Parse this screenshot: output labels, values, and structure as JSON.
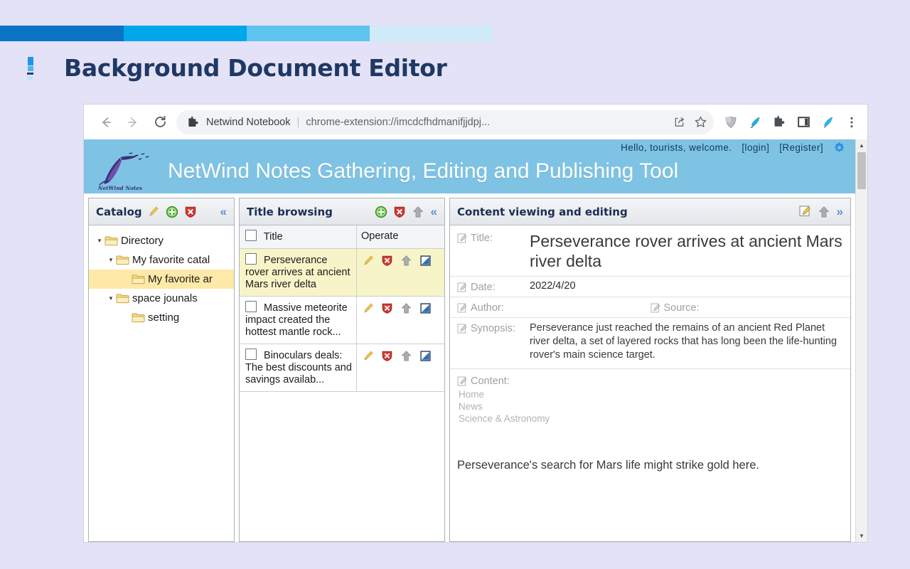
{
  "slide": {
    "title": "Background Document Editor",
    "accent_colors": [
      "#0a73c4",
      "#00a7eb",
      "#5cc4ee",
      "#cfeaf9"
    ],
    "background": "#e4e2f7"
  },
  "browser": {
    "back_icon": "back-arrow-icon",
    "forward_icon": "forward-arrow-icon",
    "reload_icon": "reload-icon",
    "omnibox": {
      "extension_icon": "puzzle-piece-icon",
      "extension_name": "Netwind Notebook",
      "separator": "|",
      "url": "chrome-extension://imcdcfhdmanifjjdpj...",
      "share_icon": "share-icon",
      "bookmark_icon": "star-icon"
    },
    "toolbar_icons": [
      "shield-extension-icon",
      "quill-pen-extension-icon",
      "extensions-puzzle-icon",
      "side-panel-icon",
      "netwind-quill-icon",
      "more-menu-icon"
    ]
  },
  "site": {
    "header_bg": "#7ec3e4",
    "greeting": "Hello, tourists, welcome.",
    "login_label": "[login]",
    "register_label": "[Register]",
    "settings_icon": "gear-icon",
    "logo_caption": "NetWind Notes",
    "brand_title": "NetWind Notes Gathering, Editing and Publishing Tool"
  },
  "catalog": {
    "header_label": "Catalog",
    "header_icons": [
      "pencil-edit-icon",
      "add-green-icon",
      "delete-red-icon",
      "collapse-left-icon"
    ],
    "tree": [
      {
        "label": "Directory",
        "depth": 0,
        "expandable": true,
        "selected": false
      },
      {
        "label": "My favorite catal",
        "depth": 1,
        "expandable": true,
        "selected": false
      },
      {
        "label": "My favorite ar",
        "depth": 2,
        "expandable": false,
        "selected": true
      },
      {
        "label": "space jounals",
        "depth": 1,
        "expandable": true,
        "selected": false
      },
      {
        "label": "setting",
        "depth": 2,
        "expandable": false,
        "selected": false
      }
    ],
    "selected_row_color": "#ffe9a8"
  },
  "title_browsing": {
    "header_label": "Title browsing",
    "header_icons": [
      "add-green-icon",
      "delete-red-icon",
      "upload-arrow-icon",
      "collapse-left-icon"
    ],
    "columns": [
      "Title",
      "Operate"
    ],
    "row_icons": [
      "pencil-edit-icon",
      "delete-red-icon",
      "upload-arrow-icon",
      "open-window-icon"
    ],
    "rows": [
      {
        "title": "Perseverance rover arrives at ancient Mars river delta",
        "selected": true
      },
      {
        "title": "Massive meteorite impact created the hottest mantle rock...",
        "selected": false
      },
      {
        "title": "Binoculars deals: The best discounts and savings availab...",
        "selected": false
      }
    ],
    "selected_row_color": "#f7f5c8"
  },
  "content": {
    "header_label": "Content viewing and editing",
    "header_icons": [
      "edit-note-icon",
      "upload-arrow-icon",
      "collapse-right-icon"
    ],
    "fields": {
      "title_label": "Title:",
      "title_value": "Perseverance rover arrives at ancient Mars river delta",
      "date_label": "Date:",
      "date_value": "2022/4/20",
      "author_label": "Author:",
      "author_value": "",
      "source_label": "Source:",
      "source_value": "",
      "synopsis_label": "Synopsis:",
      "synopsis_value": "Perseverance just reached the remains of an ancient Red Planet river delta, a set of layered rocks that has long been the life-hunting rover's main science target.",
      "content_label": "Content:"
    },
    "breadcrumbs": [
      "Home",
      "News",
      "Science & Astronomy"
    ],
    "body_text": "Perseverance's search for Mars life might strike gold here."
  },
  "scrollbar": {
    "up_arrow": "scroll-up-arrow-icon",
    "down_arrow": "scroll-down-arrow-icon"
  }
}
